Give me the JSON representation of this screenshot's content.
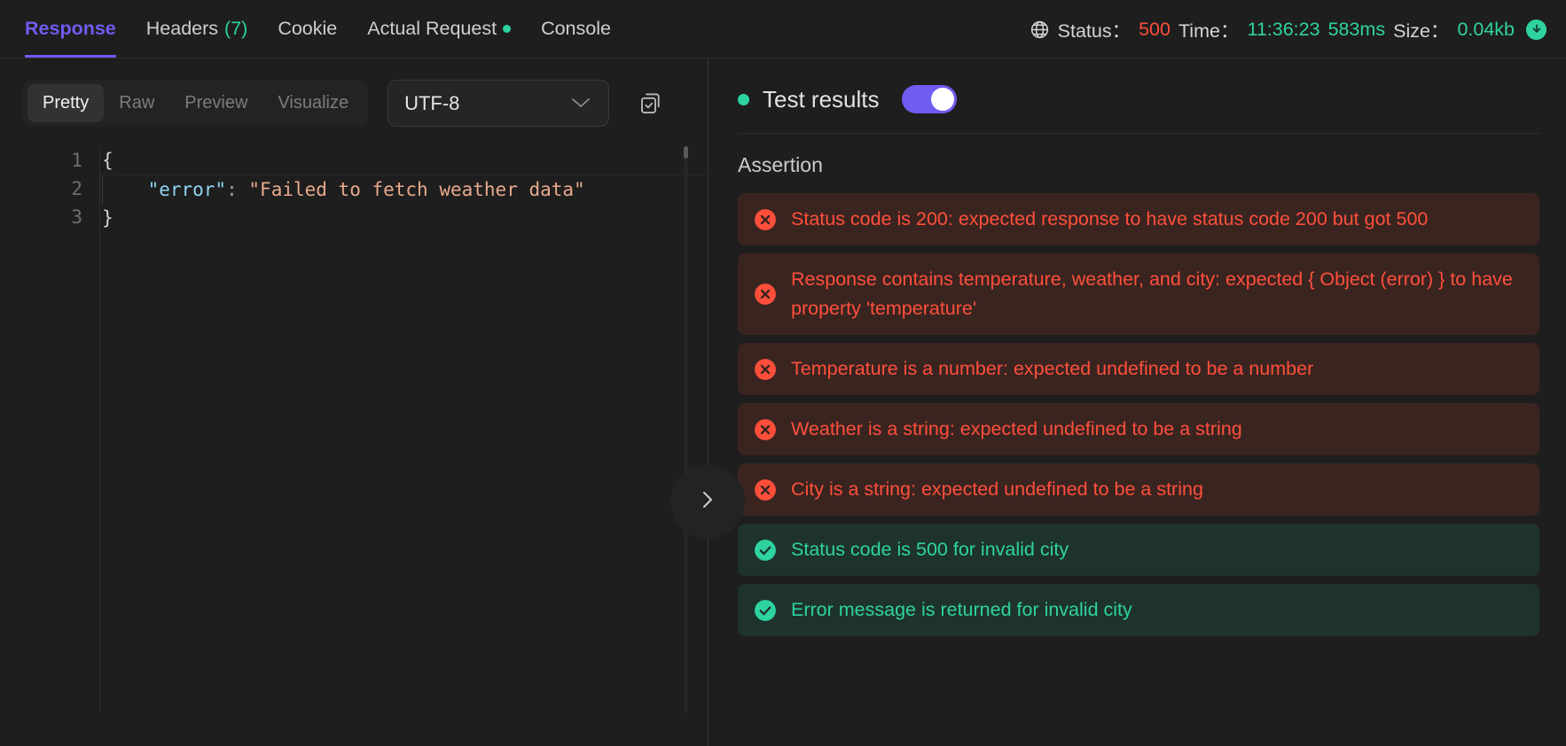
{
  "header": {
    "tabs": [
      {
        "label": "Response",
        "active": true
      },
      {
        "label": "Headers",
        "count": "(7)"
      },
      {
        "label": "Cookie"
      },
      {
        "label": "Actual Request",
        "dot": true
      },
      {
        "label": "Console"
      }
    ],
    "status": {
      "globe_icon": "globe-icon",
      "status_label": "Status：",
      "status_code": "500",
      "time_label": "Time：",
      "time_value": "11:36:23",
      "duration_value": "583ms",
      "size_label": "Size：",
      "size_value": "0.04kb",
      "download_icon": "download-icon"
    }
  },
  "toolbar": {
    "view_modes": [
      {
        "label": "Pretty",
        "active": true
      },
      {
        "label": "Raw",
        "active": false
      },
      {
        "label": "Preview",
        "active": false
      },
      {
        "label": "Visualize",
        "active": false
      }
    ],
    "encoding": {
      "value": "UTF-8",
      "chevron_icon": "chevron-down-icon"
    },
    "copy_icon": "copy-check-icon"
  },
  "editor": {
    "line_numbers": [
      "1",
      "2",
      "3"
    ],
    "lines": {
      "l1_brace": "{",
      "l2_indent": "    ",
      "l2_key": "\"error\"",
      "l2_colon": ":",
      "l2_space": " ",
      "l2_value": "\"Failed to fetch weather data\"",
      "l3_brace": "}"
    }
  },
  "divider": {
    "collapse_icon": "chevron-right-icon"
  },
  "results": {
    "status_dot": "green-status-dot",
    "title": "Test results",
    "toggle_on": true,
    "section_label": "Assertion",
    "assertions": [
      {
        "status": "fail",
        "icon": "error-circle-icon",
        "text": "Status code is 200: expected response to have status code 200 but got 500",
        "lines": 2
      },
      {
        "status": "fail",
        "icon": "error-circle-icon",
        "text": "Response contains temperature, weather, and city: expected { Object (error) } to have property 'temperature'",
        "lines": 3
      },
      {
        "status": "fail",
        "icon": "error-circle-icon",
        "text": "Temperature is a number: expected undefined to be a number",
        "lines": 2
      },
      {
        "status": "fail",
        "icon": "error-circle-icon",
        "text": "Weather is a string: expected undefined to be a string",
        "lines": 1
      },
      {
        "status": "fail",
        "icon": "error-circle-icon",
        "text": "City is a string: expected undefined to be a string",
        "lines": 1
      },
      {
        "status": "pass",
        "icon": "check-circle-icon",
        "text": "Status code is 500 for invalid city",
        "lines": 1
      },
      {
        "status": "pass",
        "icon": "check-circle-icon",
        "text": "Error message is returned for invalid city",
        "lines": 1
      }
    ]
  },
  "colors": {
    "accent_purple": "#6f5cf0",
    "success_green": "#2fd3a0",
    "error_red": "#ff4f3b",
    "background": "#1e1e1e"
  }
}
